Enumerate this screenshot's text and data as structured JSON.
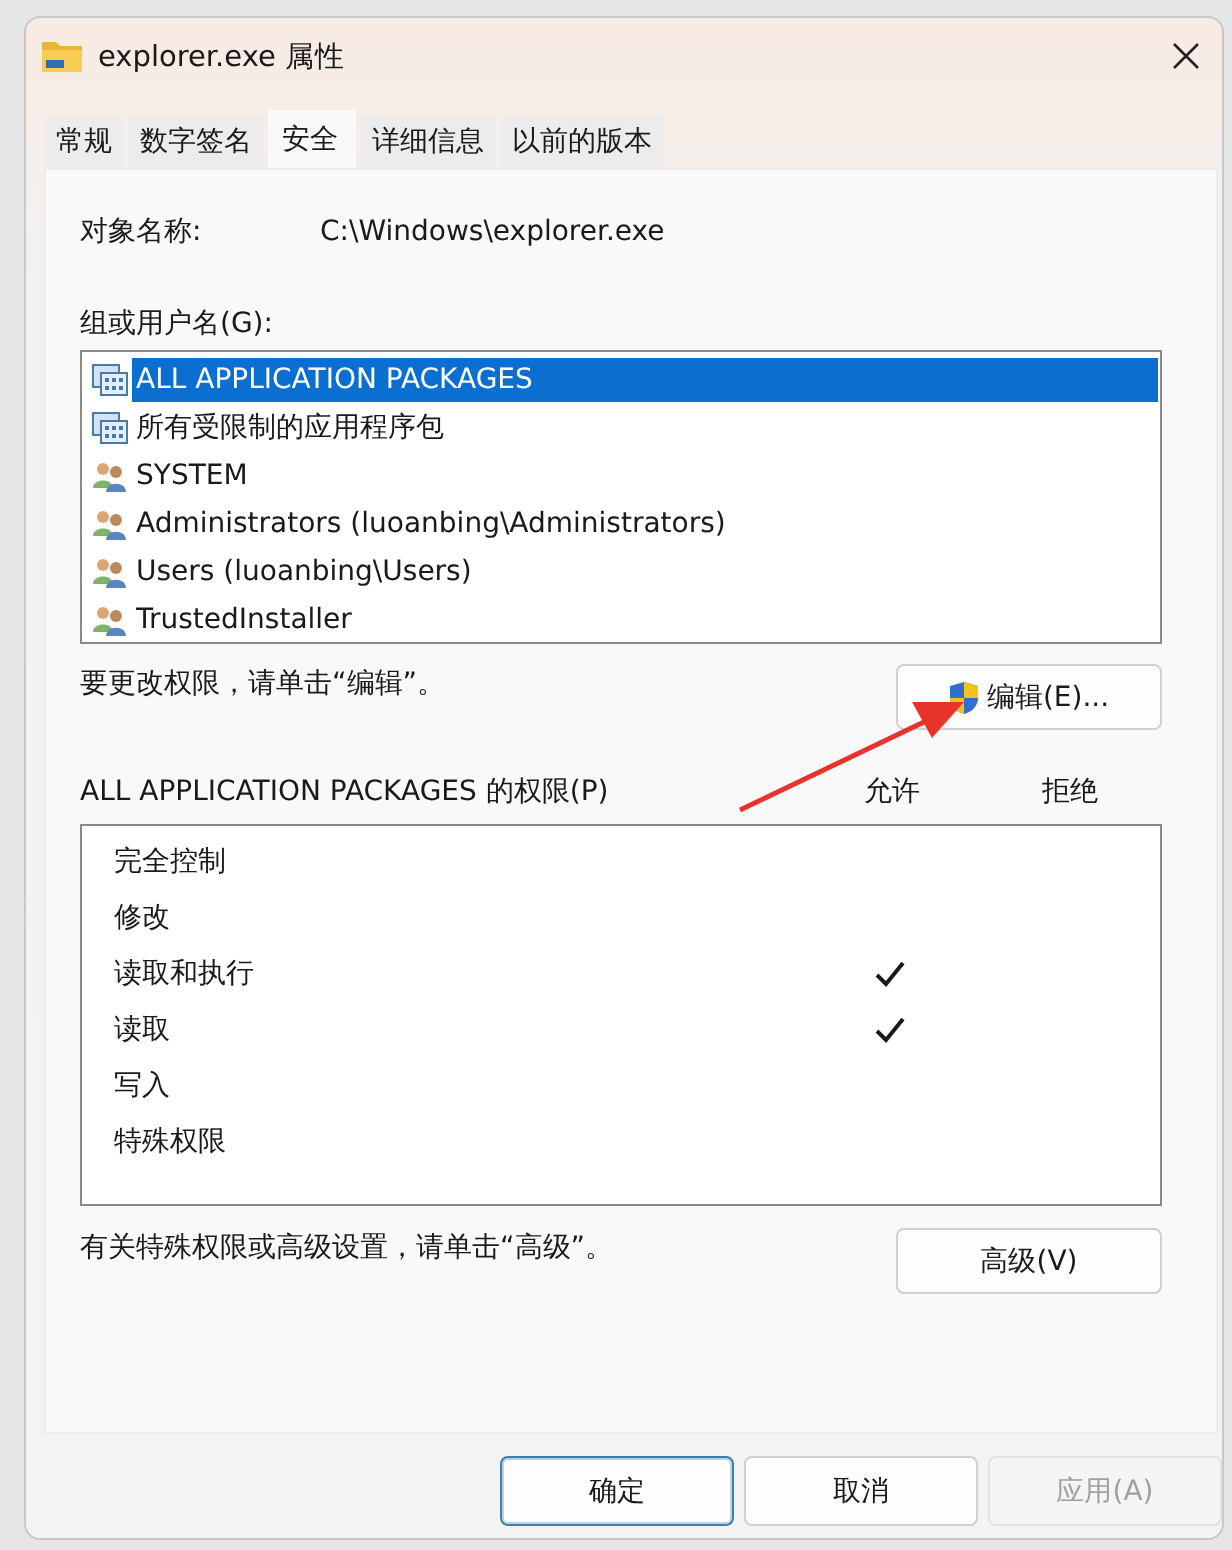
{
  "window": {
    "title": "explorer.exe 属性"
  },
  "tabs": [
    {
      "label": "常规",
      "selected": false
    },
    {
      "label": "数字签名",
      "selected": false
    },
    {
      "label": "安全",
      "selected": true
    },
    {
      "label": "详细信息",
      "selected": false
    },
    {
      "label": "以前的版本",
      "selected": false
    }
  ],
  "object_name": {
    "label": "对象名称:",
    "value": "C:\\Windows\\explorer.exe"
  },
  "groups": {
    "label": "组或用户名(G):",
    "items": [
      {
        "name": "ALL APPLICATION PACKAGES",
        "kind": "package",
        "selected": true
      },
      {
        "name": "所有受限制的应用程序包",
        "kind": "package",
        "selected": false
      },
      {
        "name": "SYSTEM",
        "kind": "users",
        "selected": false
      },
      {
        "name": "Administrators (luoanbing\\Administrators)",
        "kind": "users",
        "selected": false
      },
      {
        "name": "Users (luoanbing\\Users)",
        "kind": "users",
        "selected": false
      },
      {
        "name": "TrustedInstaller",
        "kind": "users",
        "selected": false
      }
    ]
  },
  "edit_hint": "要更改权限，请单击“编辑”。",
  "edit_button": "编辑(E)...",
  "permissions": {
    "title": "ALL APPLICATION PACKAGES 的权限(P)",
    "columns": [
      "允许",
      "拒绝"
    ],
    "rows": [
      {
        "name": "完全控制",
        "allow": false,
        "deny": false
      },
      {
        "name": "修改",
        "allow": false,
        "deny": false
      },
      {
        "name": "读取和执行",
        "allow": true,
        "deny": false
      },
      {
        "name": "读取",
        "allow": true,
        "deny": false
      },
      {
        "name": "写入",
        "allow": false,
        "deny": false
      },
      {
        "name": "特殊权限",
        "allow": false,
        "deny": false
      }
    ]
  },
  "advanced_hint": "有关特殊权限或高级设置，请单击“高级”。",
  "advanced_button": "高级(V)",
  "buttons": [
    {
      "label": "确定",
      "kind": "default",
      "disabled": false
    },
    {
      "label": "取消",
      "kind": "normal",
      "disabled": false
    },
    {
      "label": "应用(A)",
      "kind": "normal",
      "disabled": true
    }
  ],
  "annotation": {
    "kind": "arrow"
  }
}
